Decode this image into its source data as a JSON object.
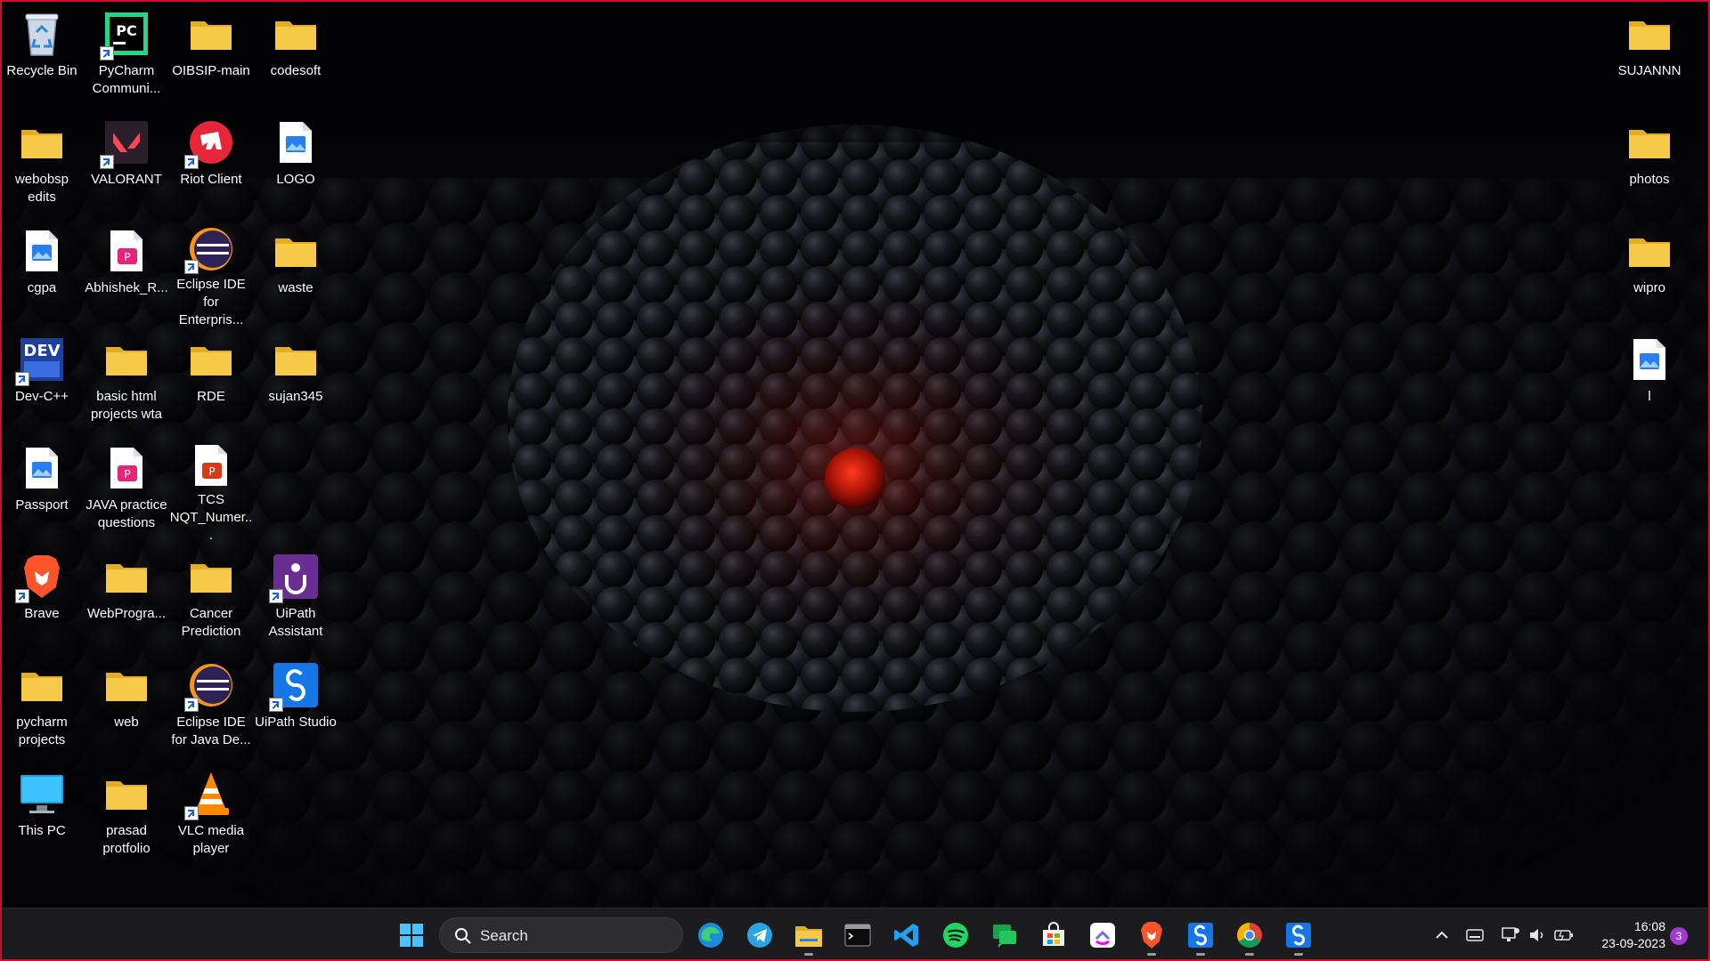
{
  "desktop": {
    "icons": [
      {
        "label": "Recycle Bin"
      },
      {
        "label": "PyCharm Communi..."
      },
      {
        "label": "OIBSIP-main"
      },
      {
        "label": "codesoft"
      },
      {
        "label": "webobsp edits"
      },
      {
        "label": "VALORANT"
      },
      {
        "label": "Riot Client"
      },
      {
        "label": "LOGO"
      },
      {
        "label": "cgpa"
      },
      {
        "label": "Abhishek_R..."
      },
      {
        "label": "Eclipse IDE for Enterpris..."
      },
      {
        "label": "waste"
      },
      {
        "label": "Dev-C++"
      },
      {
        "label": "basic html projects wta"
      },
      {
        "label": "RDE"
      },
      {
        "label": "sujan345"
      },
      {
        "label": "Passport"
      },
      {
        "label": "JAVA practice questions"
      },
      {
        "label": "TCS NQT_Numer..."
      },
      {
        "label": "Brave"
      },
      {
        "label": "WebProgra..."
      },
      {
        "label": "Cancer Prediction"
      },
      {
        "label": "UiPath Assistant"
      },
      {
        "label": "pycharm projects"
      },
      {
        "label": "web"
      },
      {
        "label": "Eclipse IDE for Java De..."
      },
      {
        "label": "UiPath Studio"
      },
      {
        "label": "This PC"
      },
      {
        "label": "prasad protfolio"
      },
      {
        "label": "VLC media player"
      },
      {
        "label": "SUJANNN"
      },
      {
        "label": "photos"
      },
      {
        "label": "wipro"
      },
      {
        "label": "l"
      }
    ]
  },
  "taskbar": {
    "search_label": "Search",
    "apps": [
      "start-icon",
      "edge-icon",
      "telegram-icon",
      "file-explorer-icon",
      "terminal-icon",
      "vscode-icon",
      "spotify-icon",
      "chat-icon",
      "microsoft-store-icon",
      "clickup-icon",
      "brave-icon",
      "uipath-icon",
      "chrome-icon",
      "uipath-studio-icon"
    ],
    "clock": {
      "time": "16:08",
      "date": "23-09-2023"
    },
    "notification_count": "3"
  },
  "colors": {
    "accent_red": "#c8102e",
    "taskbar_bg": "#1c1c1f",
    "folder_yellow": "#f3c343"
  }
}
